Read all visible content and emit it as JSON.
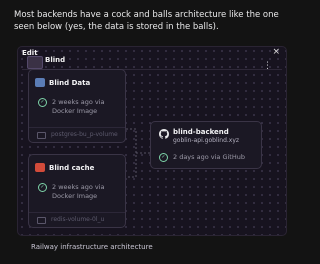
{
  "message": "Most backends have a cock and balls architecture like the one seen below (yes, the data is stored in the balls).",
  "canvas": {
    "edit_label": "Edit",
    "close_symbol": "×",
    "menu_symbol": "⋮",
    "group": {
      "title": "Blind"
    },
    "services": {
      "data": {
        "name": "Blind Data",
        "status": "2 weeks ago via Docker Image",
        "volume": "postgres-bu_p-volume",
        "icon": "postgres-icon",
        "icon_color": "#5b7db6"
      },
      "cache": {
        "name": "Blind cache",
        "status": "2 weeks ago via Docker Image",
        "volume": "redis-volume-0l_u",
        "icon": "redis-icon",
        "icon_color": "#d24b3a"
      },
      "backend": {
        "name": "blind-backend",
        "domain": "goblin-api.goblind.xyz",
        "status": "2 days ago via GitHub",
        "icon": "github-icon"
      }
    },
    "check_color": "#7dd3a8"
  },
  "caption": "Railway infrastructure architecture"
}
